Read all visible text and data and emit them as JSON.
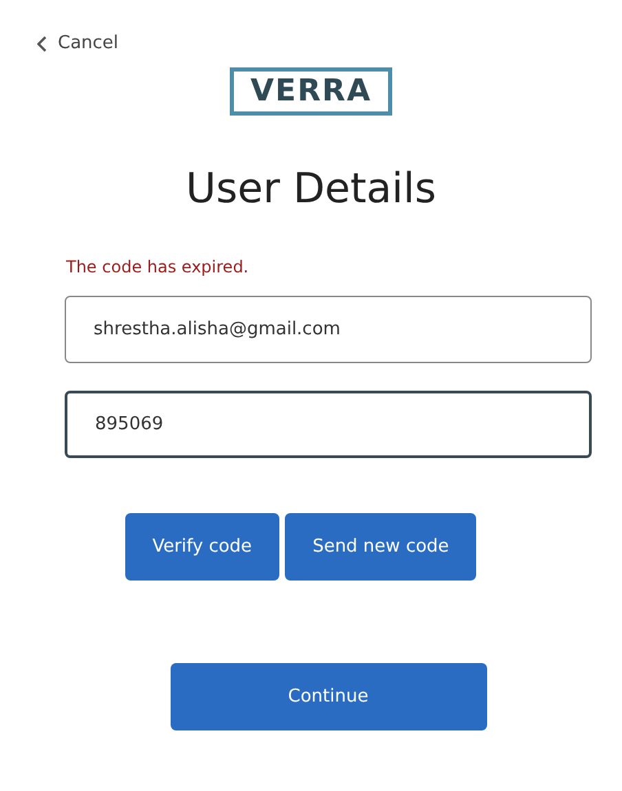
{
  "cancel_link": {
    "label": "Cancel"
  },
  "logo": {
    "text": "VERRA"
  },
  "title": "User Details",
  "error_message": "The code has expired.",
  "fields": [
    {
      "value": "shrestha.alisha@gmail.com",
      "focused": false
    },
    {
      "value": "895069",
      "focused": true
    }
  ],
  "code_buttons": [
    "Verify code",
    "Send new code"
  ],
  "continue_button": "Continue"
}
